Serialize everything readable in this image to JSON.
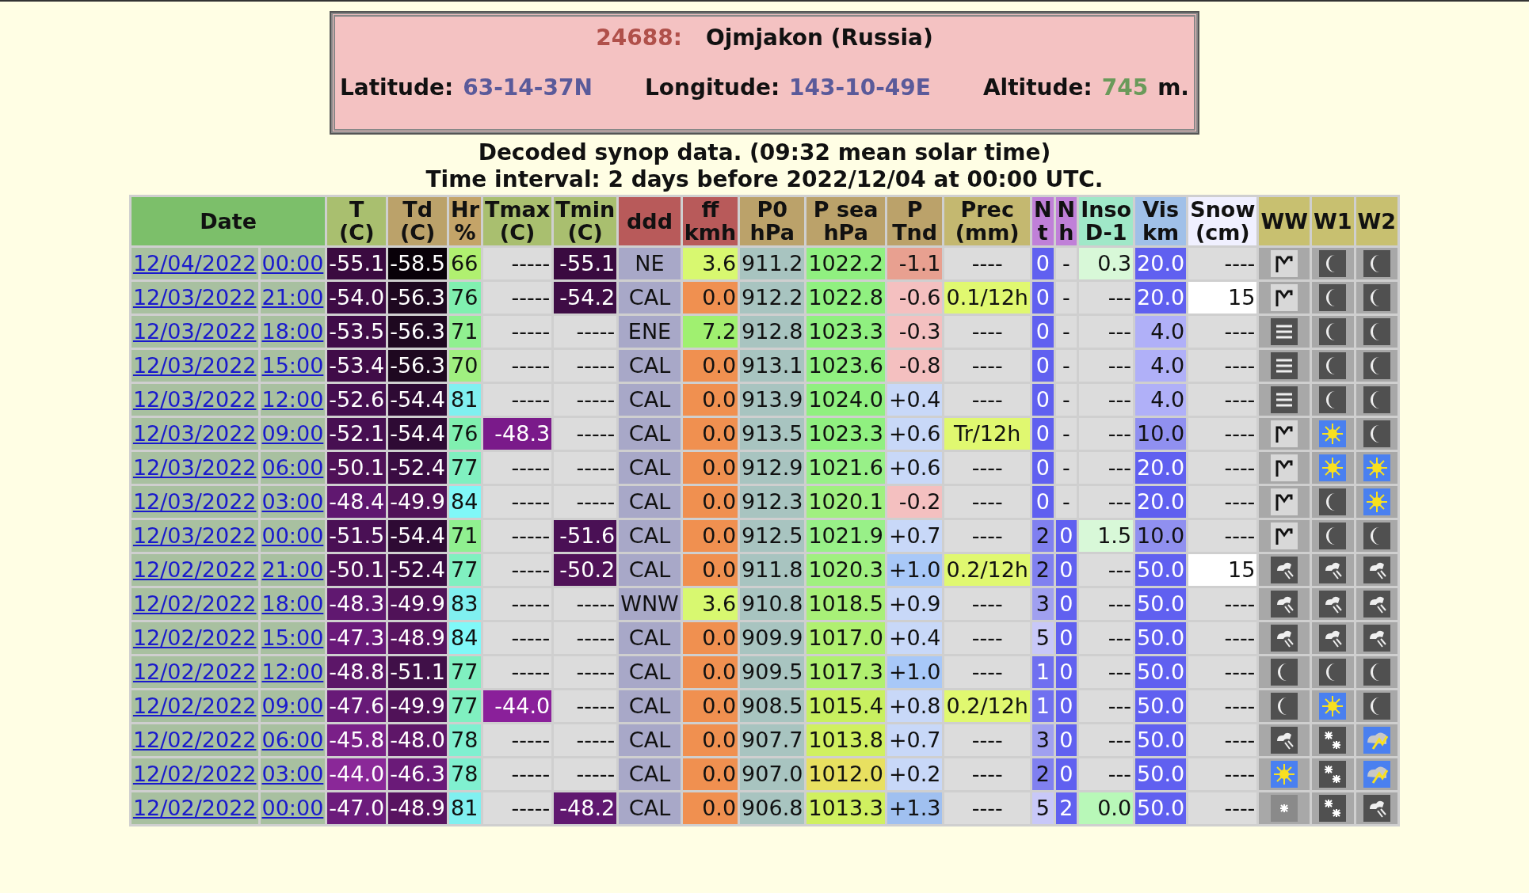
{
  "station": {
    "id": "24688:",
    "name": "Ojmjakon (Russia)",
    "latitude_label": "Latitude:",
    "latitude": "63-14-37N",
    "longitude_label": "Longitude:",
    "longitude": "143-10-49E",
    "altitude_label": "Altitude:",
    "altitude": "745",
    "altitude_unit": "m."
  },
  "captions": [
    "Decoded synop data. (09:32 mean solar time)",
    "Time interval: 2 days before 2022/12/04 at 00:00 UTC."
  ],
  "columns": [
    {
      "lines": [
        "Date"
      ],
      "color": "#7cbf6a"
    },
    {
      "lines": [
        "T",
        "(C)"
      ],
      "color": "#a9bf6f"
    },
    {
      "lines": [
        "Td",
        "(C)"
      ],
      "color": "#bba26a"
    },
    {
      "lines": [
        "Hr",
        "%"
      ],
      "color": "#c4a468"
    },
    {
      "lines": [
        "Tmax",
        "(C)"
      ],
      "color": "#a9bf6f"
    },
    {
      "lines": [
        "Tmin",
        "(C)"
      ],
      "color": "#a9bf6f"
    },
    {
      "lines": [
        "ddd"
      ],
      "color": "#b85a5a"
    },
    {
      "lines": [
        "ff",
        "kmh"
      ],
      "color": "#b85a5a"
    },
    {
      "lines": [
        "P0",
        "hPa"
      ],
      "color": "#bba26a"
    },
    {
      "lines": [
        "P sea",
        "hPa"
      ],
      "color": "#bba26a"
    },
    {
      "lines": [
        "P",
        "Tnd"
      ],
      "color": "#bba26a"
    },
    {
      "lines": [
        "Prec",
        "(mm)"
      ],
      "color": "#c4b870"
    },
    {
      "lines": [
        "N",
        "t"
      ],
      "color": "#c080d8"
    },
    {
      "lines": [
        "N",
        "h"
      ],
      "color": "#c080d8"
    },
    {
      "lines": [
        "Inso",
        "D-1"
      ],
      "color": "#a0e8c8"
    },
    {
      "lines": [
        "Vis",
        "km"
      ],
      "color": "#a0c0e8"
    },
    {
      "lines": [
        "Snow",
        "(cm)"
      ],
      "color": "#f0f0ff"
    },
    {
      "lines": [
        "WW"
      ],
      "color": "#c8c070"
    },
    {
      "lines": [
        "W1"
      ],
      "color": "#c8c070"
    },
    {
      "lines": [
        "W2"
      ],
      "color": "#c8c070"
    }
  ],
  "rows": [
    {
      "date": "12/04/2022",
      "time": "00:00",
      "cells": [
        {
          "text": "-55.1",
          "color": "#3a0a40"
        },
        {
          "text": "-58.5",
          "color": "#080008"
        },
        {
          "text": "66",
          "color": "#b0f070"
        },
        {
          "text": "-----",
          "color": "#dcdcdc"
        },
        {
          "text": "-55.1",
          "color": "#3a0a40"
        },
        {
          "text": "NE",
          "color": "#a8a8c8"
        },
        {
          "text": "3.6",
          "color": "#d8f870"
        },
        {
          "text": "911.2",
          "color": "#a8c4c0"
        },
        {
          "text": "1022.2",
          "color": "#90f080"
        },
        {
          "text": "-1.1",
          "color": "#e8a090"
        },
        {
          "text": "----",
          "color": "#dcdcdc"
        },
        {
          "text": "0",
          "color": "#6060f0"
        },
        {
          "text": "-",
          "color": "#dcdcdc"
        },
        {
          "text": "0.3",
          "color": "#d8f8d8"
        },
        {
          "text": "20.0",
          "color": "#6060f0"
        },
        {
          "text": "----",
          "color": "#dcdcdc"
        }
      ],
      "icons": [
        {
          "kind": "peak"
        },
        {
          "kind": "moon"
        },
        {
          "kind": "moon"
        }
      ]
    },
    {
      "date": "12/03/2022",
      "time": "21:00",
      "cells": [
        {
          "text": "-54.0",
          "color": "#3e0c45"
        },
        {
          "text": "-56.3",
          "color": "#1e0820"
        },
        {
          "text": "76",
          "color": "#80f0b0"
        },
        {
          "text": "-----",
          "color": "#dcdcdc"
        },
        {
          "text": "-54.2",
          "color": "#3e0c45"
        },
        {
          "text": "CAL",
          "color": "#a8a8c8"
        },
        {
          "text": "0.0",
          "color": "#f09050"
        },
        {
          "text": "912.2",
          "color": "#a8c4c0"
        },
        {
          "text": "1022.8",
          "color": "#90f080"
        },
        {
          "text": "-0.6",
          "color": "#f4c0c0"
        },
        {
          "text": "0.1/12h",
          "color": "#e0f870"
        },
        {
          "text": "0",
          "color": "#6060f0"
        },
        {
          "text": "-",
          "color": "#dcdcdc"
        },
        {
          "text": "---",
          "color": "#dcdcdc"
        },
        {
          "text": "20.0",
          "color": "#6060f0"
        },
        {
          "text": "15",
          "color": "#ffffff"
        }
      ],
      "icons": [
        {
          "kind": "peak"
        },
        {
          "kind": "moon"
        },
        {
          "kind": "moon"
        }
      ]
    },
    {
      "date": "12/03/2022",
      "time": "18:00",
      "cells": [
        {
          "text": "-53.5",
          "color": "#400c48"
        },
        {
          "text": "-56.3",
          "color": "#1e0820"
        },
        {
          "text": "71",
          "color": "#90f090"
        },
        {
          "text": "-----",
          "color": "#dcdcdc"
        },
        {
          "text": "-----",
          "color": "#dcdcdc"
        },
        {
          "text": "ENE",
          "color": "#a8a8c8"
        },
        {
          "text": "7.2",
          "color": "#a0f070"
        },
        {
          "text": "912.8",
          "color": "#a8c4c0"
        },
        {
          "text": "1023.3",
          "color": "#90f080"
        },
        {
          "text": "-0.3",
          "color": "#f4c0c0"
        },
        {
          "text": "----",
          "color": "#dcdcdc"
        },
        {
          "text": "0",
          "color": "#6060f0"
        },
        {
          "text": "-",
          "color": "#dcdcdc"
        },
        {
          "text": "---",
          "color": "#dcdcdc"
        },
        {
          "text": "4.0",
          "color": "#b0b0f8"
        },
        {
          "text": "----",
          "color": "#dcdcdc"
        }
      ],
      "icons": [
        {
          "kind": "fog"
        },
        {
          "kind": "moon"
        },
        {
          "kind": "moon"
        }
      ]
    },
    {
      "date": "12/03/2022",
      "time": "15:00",
      "cells": [
        {
          "text": "-53.4",
          "color": "#400c48"
        },
        {
          "text": "-56.3",
          "color": "#1e0820"
        },
        {
          "text": "70",
          "color": "#a0f080"
        },
        {
          "text": "-----",
          "color": "#dcdcdc"
        },
        {
          "text": "-----",
          "color": "#dcdcdc"
        },
        {
          "text": "CAL",
          "color": "#a8a8c8"
        },
        {
          "text": "0.0",
          "color": "#f09050"
        },
        {
          "text": "913.1",
          "color": "#a8c4c0"
        },
        {
          "text": "1023.6",
          "color": "#90f080"
        },
        {
          "text": "-0.8",
          "color": "#f4c0c0"
        },
        {
          "text": "----",
          "color": "#dcdcdc"
        },
        {
          "text": "0",
          "color": "#6060f0"
        },
        {
          "text": "-",
          "color": "#dcdcdc"
        },
        {
          "text": "---",
          "color": "#dcdcdc"
        },
        {
          "text": "4.0",
          "color": "#b0b0f8"
        },
        {
          "text": "----",
          "color": "#dcdcdc"
        }
      ],
      "icons": [
        {
          "kind": "fog"
        },
        {
          "kind": "moon"
        },
        {
          "kind": "moon"
        }
      ]
    },
    {
      "date": "12/03/2022",
      "time": "12:00",
      "cells": [
        {
          "text": "-52.6",
          "color": "#450e50"
        },
        {
          "text": "-54.4",
          "color": "#2e0a34"
        },
        {
          "text": "81",
          "color": "#80f0f0"
        },
        {
          "text": "-----",
          "color": "#dcdcdc"
        },
        {
          "text": "-----",
          "color": "#dcdcdc"
        },
        {
          "text": "CAL",
          "color": "#a8a8c8"
        },
        {
          "text": "0.0",
          "color": "#f09050"
        },
        {
          "text": "913.9",
          "color": "#a8c4c0"
        },
        {
          "text": "1024.0",
          "color": "#90f080"
        },
        {
          "text": "+0.4",
          "color": "#c8d8f8"
        },
        {
          "text": "----",
          "color": "#dcdcdc"
        },
        {
          "text": "0",
          "color": "#6060f0"
        },
        {
          "text": "-",
          "color": "#dcdcdc"
        },
        {
          "text": "---",
          "color": "#dcdcdc"
        },
        {
          "text": "4.0",
          "color": "#b0b0f8"
        },
        {
          "text": "----",
          "color": "#dcdcdc"
        }
      ],
      "icons": [
        {
          "kind": "fog"
        },
        {
          "kind": "moon"
        },
        {
          "kind": "moon"
        }
      ]
    },
    {
      "date": "12/03/2022",
      "time": "09:00",
      "cells": [
        {
          "text": "-52.1",
          "color": "#470f52"
        },
        {
          "text": "-54.4",
          "color": "#2e0a34"
        },
        {
          "text": "76",
          "color": "#80f0b0"
        },
        {
          "text": "-48.3",
          "color": "#7a1a8a"
        },
        {
          "text": "-----",
          "color": "#dcdcdc"
        },
        {
          "text": "CAL",
          "color": "#a8a8c8"
        },
        {
          "text": "0.0",
          "color": "#f09050"
        },
        {
          "text": "913.5",
          "color": "#a8c4c0"
        },
        {
          "text": "1023.3",
          "color": "#90f080"
        },
        {
          "text": "+0.6",
          "color": "#c8d8f8"
        },
        {
          "text": "Tr/12h",
          "color": "#e0f870"
        },
        {
          "text": "0",
          "color": "#6060f0"
        },
        {
          "text": "-",
          "color": "#dcdcdc"
        },
        {
          "text": "---",
          "color": "#dcdcdc"
        },
        {
          "text": "10.0",
          "color": "#9090f0"
        },
        {
          "text": "----",
          "color": "#dcdcdc"
        }
      ],
      "icons": [
        {
          "kind": "peak"
        },
        {
          "kind": "sun"
        },
        {
          "kind": "moon"
        }
      ]
    },
    {
      "date": "12/03/2022",
      "time": "06:00",
      "cells": [
        {
          "text": "-50.1",
          "color": "#501258"
        },
        {
          "text": "-52.4",
          "color": "#3a0c42"
        },
        {
          "text": "77",
          "color": "#80f0c0"
        },
        {
          "text": "-----",
          "color": "#dcdcdc"
        },
        {
          "text": "-----",
          "color": "#dcdcdc"
        },
        {
          "text": "CAL",
          "color": "#a8a8c8"
        },
        {
          "text": "0.0",
          "color": "#f09050"
        },
        {
          "text": "912.9",
          "color": "#a8c4c0"
        },
        {
          "text": "1021.6",
          "color": "#98f088"
        },
        {
          "text": "+0.6",
          "color": "#c8d8f8"
        },
        {
          "text": "----",
          "color": "#dcdcdc"
        },
        {
          "text": "0",
          "color": "#6060f0"
        },
        {
          "text": "-",
          "color": "#dcdcdc"
        },
        {
          "text": "---",
          "color": "#dcdcdc"
        },
        {
          "text": "20.0",
          "color": "#6060f0"
        },
        {
          "text": "----",
          "color": "#dcdcdc"
        }
      ],
      "icons": [
        {
          "kind": "peak"
        },
        {
          "kind": "sun"
        },
        {
          "kind": "sun"
        }
      ]
    },
    {
      "date": "12/03/2022",
      "time": "03:00",
      "cells": [
        {
          "text": "-48.4",
          "color": "#601870"
        },
        {
          "text": "-49.9",
          "color": "#501258"
        },
        {
          "text": "84",
          "color": "#80f8f8"
        },
        {
          "text": "-----",
          "color": "#dcdcdc"
        },
        {
          "text": "-----",
          "color": "#dcdcdc"
        },
        {
          "text": "CAL",
          "color": "#a8a8c8"
        },
        {
          "text": "0.0",
          "color": "#f09050"
        },
        {
          "text": "912.3",
          "color": "#a8c4c0"
        },
        {
          "text": "1020.1",
          "color": "#a0f080"
        },
        {
          "text": "-0.2",
          "color": "#f4c0c0"
        },
        {
          "text": "----",
          "color": "#dcdcdc"
        },
        {
          "text": "0",
          "color": "#6060f0"
        },
        {
          "text": "-",
          "color": "#dcdcdc"
        },
        {
          "text": "---",
          "color": "#dcdcdc"
        },
        {
          "text": "20.0",
          "color": "#6060f0"
        },
        {
          "text": "----",
          "color": "#dcdcdc"
        }
      ],
      "icons": [
        {
          "kind": "peak"
        },
        {
          "kind": "moon"
        },
        {
          "kind": "sun"
        }
      ]
    },
    {
      "date": "12/03/2022",
      "time": "00:00",
      "cells": [
        {
          "text": "-51.5",
          "color": "#4a1055"
        },
        {
          "text": "-54.4",
          "color": "#2e0a34"
        },
        {
          "text": "71",
          "color": "#90f090"
        },
        {
          "text": "-----",
          "color": "#dcdcdc"
        },
        {
          "text": "-51.6",
          "color": "#4a1055"
        },
        {
          "text": "CAL",
          "color": "#a8a8c8"
        },
        {
          "text": "0.0",
          "color": "#f09050"
        },
        {
          "text": "912.5",
          "color": "#a8c4c0"
        },
        {
          "text": "1021.9",
          "color": "#98f088"
        },
        {
          "text": "+0.7",
          "color": "#c8d8f8"
        },
        {
          "text": "----",
          "color": "#dcdcdc"
        },
        {
          "text": "2",
          "color": "#8080f0"
        },
        {
          "text": "0",
          "color": "#6060f0"
        },
        {
          "text": "1.5",
          "color": "#d8f8d8"
        },
        {
          "text": "10.0",
          "color": "#9090f0"
        },
        {
          "text": "----",
          "color": "#dcdcdc"
        }
      ],
      "icons": [
        {
          "kind": "peak"
        },
        {
          "kind": "moon"
        },
        {
          "kind": "moon"
        }
      ]
    },
    {
      "date": "12/02/2022",
      "time": "21:00",
      "cells": [
        {
          "text": "-50.1",
          "color": "#501258"
        },
        {
          "text": "-52.4",
          "color": "#3a0c42"
        },
        {
          "text": "77",
          "color": "#80f0c0"
        },
        {
          "text": "-----",
          "color": "#dcdcdc"
        },
        {
          "text": "-50.2",
          "color": "#501258"
        },
        {
          "text": "CAL",
          "color": "#a8a8c8"
        },
        {
          "text": "0.0",
          "color": "#f09050"
        },
        {
          "text": "911.8",
          "color": "#a8c4c0"
        },
        {
          "text": "1020.3",
          "color": "#a0f080"
        },
        {
          "text": "+1.0",
          "color": "#a8c8f8"
        },
        {
          "text": "0.2/12h",
          "color": "#e0f870"
        },
        {
          "text": "2",
          "color": "#8080f0"
        },
        {
          "text": "0",
          "color": "#6060f0"
        },
        {
          "text": "---",
          "color": "#dcdcdc"
        },
        {
          "text": "50.0",
          "color": "#6060f0"
        },
        {
          "text": "15",
          "color": "#ffffff"
        }
      ],
      "icons": [
        {
          "kind": "cloud"
        },
        {
          "kind": "cloud"
        },
        {
          "kind": "cloud"
        }
      ]
    },
    {
      "date": "12/02/2022",
      "time": "18:00",
      "cells": [
        {
          "text": "-48.3",
          "color": "#601870"
        },
        {
          "text": "-49.9",
          "color": "#501258"
        },
        {
          "text": "83",
          "color": "#80f0f0"
        },
        {
          "text": "-----",
          "color": "#dcdcdc"
        },
        {
          "text": "-----",
          "color": "#dcdcdc"
        },
        {
          "text": "WNW",
          "color": "#a8a8c8"
        },
        {
          "text": "3.6",
          "color": "#d8f870"
        },
        {
          "text": "910.8",
          "color": "#a8c4c0"
        },
        {
          "text": "1018.5",
          "color": "#a8f078"
        },
        {
          "text": "+0.9",
          "color": "#c8d8f8"
        },
        {
          "text": "----",
          "color": "#dcdcdc"
        },
        {
          "text": "3",
          "color": "#a0a0f0"
        },
        {
          "text": "0",
          "color": "#6060f0"
        },
        {
          "text": "---",
          "color": "#dcdcdc"
        },
        {
          "text": "50.0",
          "color": "#6060f0"
        },
        {
          "text": "----",
          "color": "#dcdcdc"
        }
      ],
      "icons": [
        {
          "kind": "cloud"
        },
        {
          "kind": "cloud"
        },
        {
          "kind": "cloud"
        }
      ]
    },
    {
      "date": "12/02/2022",
      "time": "15:00",
      "cells": [
        {
          "text": "-47.3",
          "color": "#6a1a7a"
        },
        {
          "text": "-48.9",
          "color": "#581460"
        },
        {
          "text": "84",
          "color": "#80f8f8"
        },
        {
          "text": "-----",
          "color": "#dcdcdc"
        },
        {
          "text": "-----",
          "color": "#dcdcdc"
        },
        {
          "text": "CAL",
          "color": "#a8a8c8"
        },
        {
          "text": "0.0",
          "color": "#f09050"
        },
        {
          "text": "909.9",
          "color": "#a8c4c0"
        },
        {
          "text": "1017.0",
          "color": "#b0f070"
        },
        {
          "text": "+0.4",
          "color": "#c8d8f8"
        },
        {
          "text": "----",
          "color": "#dcdcdc"
        },
        {
          "text": "5",
          "color": "#c8c8f8"
        },
        {
          "text": "0",
          "color": "#6060f0"
        },
        {
          "text": "---",
          "color": "#dcdcdc"
        },
        {
          "text": "50.0",
          "color": "#6060f0"
        },
        {
          "text": "----",
          "color": "#dcdcdc"
        }
      ],
      "icons": [
        {
          "kind": "cloud"
        },
        {
          "kind": "cloud"
        },
        {
          "kind": "cloud"
        }
      ]
    },
    {
      "date": "12/02/2022",
      "time": "12:00",
      "cells": [
        {
          "text": "-48.8",
          "color": "#5c1668"
        },
        {
          "text": "-51.1",
          "color": "#401048"
        },
        {
          "text": "77",
          "color": "#80f0c0"
        },
        {
          "text": "-----",
          "color": "#dcdcdc"
        },
        {
          "text": "-----",
          "color": "#dcdcdc"
        },
        {
          "text": "CAL",
          "color": "#a8a8c8"
        },
        {
          "text": "0.0",
          "color": "#f09050"
        },
        {
          "text": "909.5",
          "color": "#a8c4c0"
        },
        {
          "text": "1017.3",
          "color": "#b0f070"
        },
        {
          "text": "+1.0",
          "color": "#a8c8f8"
        },
        {
          "text": "----",
          "color": "#dcdcdc"
        },
        {
          "text": "1",
          "color": "#7070f0"
        },
        {
          "text": "0",
          "color": "#6060f0"
        },
        {
          "text": "---",
          "color": "#dcdcdc"
        },
        {
          "text": "50.0",
          "color": "#6060f0"
        },
        {
          "text": "----",
          "color": "#dcdcdc"
        }
      ],
      "icons": [
        {
          "kind": "moon"
        },
        {
          "kind": "moon"
        },
        {
          "kind": "moon"
        }
      ]
    },
    {
      "date": "12/02/2022",
      "time": "09:00",
      "cells": [
        {
          "text": "-47.6",
          "color": "#681a78"
        },
        {
          "text": "-49.9",
          "color": "#501258"
        },
        {
          "text": "77",
          "color": "#80f0c0"
        },
        {
          "text": "-44.0",
          "color": "#8a209a"
        },
        {
          "text": "-----",
          "color": "#dcdcdc"
        },
        {
          "text": "CAL",
          "color": "#a8a8c8"
        },
        {
          "text": "0.0",
          "color": "#f09050"
        },
        {
          "text": "908.5",
          "color": "#a8c4c0"
        },
        {
          "text": "1015.4",
          "color": "#c8f060"
        },
        {
          "text": "+0.8",
          "color": "#c8d8f8"
        },
        {
          "text": "0.2/12h",
          "color": "#e0f870"
        },
        {
          "text": "1",
          "color": "#7070f0"
        },
        {
          "text": "0",
          "color": "#6060f0"
        },
        {
          "text": "---",
          "color": "#dcdcdc"
        },
        {
          "text": "50.0",
          "color": "#6060f0"
        },
        {
          "text": "----",
          "color": "#dcdcdc"
        }
      ],
      "icons": [
        {
          "kind": "moon"
        },
        {
          "kind": "sun"
        },
        {
          "kind": "moon"
        }
      ]
    },
    {
      "date": "12/02/2022",
      "time": "06:00",
      "cells": [
        {
          "text": "-45.8",
          "color": "#7a2088"
        },
        {
          "text": "-48.0",
          "color": "#5e1668"
        },
        {
          "text": "78",
          "color": "#80f0d0"
        },
        {
          "text": "-----",
          "color": "#dcdcdc"
        },
        {
          "text": "-----",
          "color": "#dcdcdc"
        },
        {
          "text": "CAL",
          "color": "#a8a8c8"
        },
        {
          "text": "0.0",
          "color": "#f09050"
        },
        {
          "text": "907.7",
          "color": "#a8c4c0"
        },
        {
          "text": "1013.8",
          "color": "#d0f060"
        },
        {
          "text": "+0.7",
          "color": "#c8d8f8"
        },
        {
          "text": "----",
          "color": "#dcdcdc"
        },
        {
          "text": "3",
          "color": "#a0a0f0"
        },
        {
          "text": "0",
          "color": "#6060f0"
        },
        {
          "text": "---",
          "color": "#dcdcdc"
        },
        {
          "text": "50.0",
          "color": "#6060f0"
        },
        {
          "text": "----",
          "color": "#dcdcdc"
        }
      ],
      "icons": [
        {
          "kind": "cloud"
        },
        {
          "kind": "snow2"
        },
        {
          "kind": "cloud_sun"
        }
      ]
    },
    {
      "date": "12/02/2022",
      "time": "03:00",
      "cells": [
        {
          "text": "-44.0",
          "color": "#8a2898"
        },
        {
          "text": "-46.3",
          "color": "#6a1a78"
        },
        {
          "text": "78",
          "color": "#80f0d0"
        },
        {
          "text": "-----",
          "color": "#dcdcdc"
        },
        {
          "text": "-----",
          "color": "#dcdcdc"
        },
        {
          "text": "CAL",
          "color": "#a8a8c8"
        },
        {
          "text": "0.0",
          "color": "#f09050"
        },
        {
          "text": "907.0",
          "color": "#a8c4c0"
        },
        {
          "text": "1012.0",
          "color": "#e8e060"
        },
        {
          "text": "+0.2",
          "color": "#c8d8f8"
        },
        {
          "text": "----",
          "color": "#dcdcdc"
        },
        {
          "text": "2",
          "color": "#8080f0"
        },
        {
          "text": "0",
          "color": "#6060f0"
        },
        {
          "text": "---",
          "color": "#dcdcdc"
        },
        {
          "text": "50.0",
          "color": "#6060f0"
        },
        {
          "text": "----",
          "color": "#dcdcdc"
        }
      ],
      "icons": [
        {
          "kind": "sun"
        },
        {
          "kind": "snow2"
        },
        {
          "kind": "cloud_sun"
        }
      ]
    },
    {
      "date": "12/02/2022",
      "time": "00:00",
      "cells": [
        {
          "text": "-47.0",
          "color": "#6c1c7c"
        },
        {
          "text": "-48.9",
          "color": "#581460"
        },
        {
          "text": "81",
          "color": "#80f0f0"
        },
        {
          "text": "-----",
          "color": "#dcdcdc"
        },
        {
          "text": "-48.2",
          "color": "#601870"
        },
        {
          "text": "CAL",
          "color": "#a8a8c8"
        },
        {
          "text": "0.0",
          "color": "#f09050"
        },
        {
          "text": "906.8",
          "color": "#a8c4c0"
        },
        {
          "text": "1013.3",
          "color": "#d0f060"
        },
        {
          "text": "+1.3",
          "color": "#a0c0f0"
        },
        {
          "text": "----",
          "color": "#dcdcdc"
        },
        {
          "text": "5",
          "color": "#c8c8f8"
        },
        {
          "text": "2",
          "color": "#6060f0"
        },
        {
          "text": "0.0",
          "color": "#b8f8b8"
        },
        {
          "text": "50.0",
          "color": "#6060f0"
        },
        {
          "text": "----",
          "color": "#dcdcdc"
        }
      ],
      "icons": [
        {
          "kind": "snow"
        },
        {
          "kind": "snow2"
        },
        {
          "kind": "cloud"
        }
      ]
    }
  ]
}
